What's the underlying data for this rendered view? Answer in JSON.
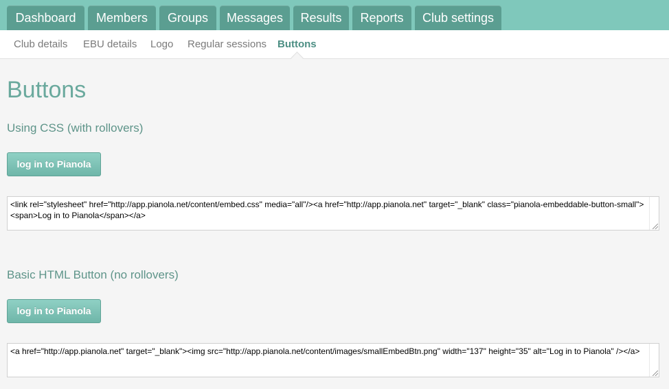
{
  "topnav": {
    "tabs": [
      "Dashboard",
      "Members",
      "Groups",
      "Messages",
      "Results",
      "Reports",
      "Club settings"
    ]
  },
  "subnav": {
    "items": [
      "Club details",
      "EBU details",
      "Logo",
      "Regular sessions",
      "Buttons"
    ],
    "active": "Buttons"
  },
  "page": {
    "title": "Buttons",
    "sections": [
      {
        "title": "Using CSS (with rollovers)",
        "button_label": "log in to Pianola",
        "code": "<link rel=\"stylesheet\" href=\"http://app.pianola.net/content/embed.css\" media=\"all\"/><a href=\"http://app.pianola.net\" target=\"_blank\" class=\"pianola-embeddable-button-small\"><span>Log in to Pianola</span></a>"
      },
      {
        "title": "Basic HTML Button (no rollovers)",
        "button_label": "log in to Pianola",
        "code": "<a href=\"http://app.pianola.net\" target=\"_blank\"><img src=\"http://app.pianola.net/content/images/smallEmbedBtn.png\" width=\"137\" height=\"35\" alt=\"Log in to Pianola\" /></a>"
      }
    ]
  },
  "colors": {
    "topnav_bg": "#7fc8bb",
    "tab_bg": "#5b9e91",
    "accent_text": "#6aa99d",
    "button_bg": "#7fc2b6"
  }
}
